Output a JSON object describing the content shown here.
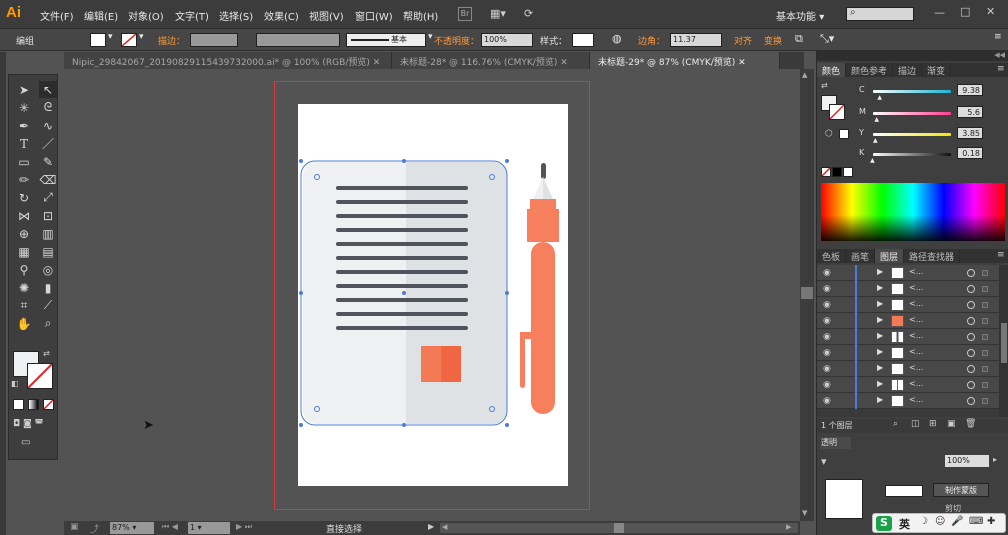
{
  "app": {
    "logo": "Ai"
  },
  "menu": [
    "文件(F)",
    "编辑(E)",
    "对象(O)",
    "文字(T)",
    "选择(S)",
    "效果(C)",
    "视图(V)",
    "窗口(W)",
    "帮助(H)"
  ],
  "workspace": {
    "label": "基本功能",
    "chevron": "▾"
  },
  "search": {
    "icon": "search-icon",
    "placeholder": ""
  },
  "control_bar": {
    "group_label": "编组",
    "stroke_label": "描边：",
    "stroke_style": "基本",
    "opacity_label": "不透明度：",
    "opacity_value": "100%",
    "style_label": "样式：",
    "corner_label": "边角：",
    "corner_value": "11.37",
    "align_label": "对齐",
    "transform_label": "变换"
  },
  "tabs": [
    {
      "label": "Nipic_29842067_20190829115439732000.ai* @ 100% (RGB/预览)",
      "close": "✕"
    },
    {
      "label": "未标题-28* @ 116.76% (CMYK/预览)",
      "close": "✕"
    },
    {
      "label": "未标题-29* @ 87% (CMYK/预览)",
      "close": "✕"
    }
  ],
  "status": {
    "zoom": "87%",
    "page": "1",
    "tool": "直接选择"
  },
  "color_panel": {
    "tabs": [
      "颜色",
      "颜色参考",
      "描边",
      "渐变"
    ],
    "channels": [
      {
        "name": "C",
        "value": "9.38",
        "color": "#17b5d1",
        "level": 0.0938
      },
      {
        "name": "M",
        "value": "5.6",
        "color": "#ff3d91",
        "level": 0.056
      },
      {
        "name": "Y",
        "value": "3.85",
        "color": "#f2e600",
        "level": 0.0385
      },
      {
        "name": "K",
        "value": "0.18",
        "color": "#111111",
        "level": 0.0018
      }
    ]
  },
  "layers_panel": {
    "tabs": [
      "色板",
      "画笔",
      "图层",
      "路径查找器"
    ],
    "rows": [
      {
        "name": "<...",
        "thumb": "white"
      },
      {
        "name": "<...",
        "thumb": "white"
      },
      {
        "name": "<...",
        "thumb": "white"
      },
      {
        "name": "<...",
        "thumb": "orange"
      },
      {
        "name": "<...",
        "thumb": "stripe"
      },
      {
        "name": "<...",
        "thumb": "white"
      },
      {
        "name": "<...",
        "thumb": "white"
      },
      {
        "name": "<...",
        "thumb": "red-line"
      },
      {
        "name": "<...",
        "thumb": "white"
      }
    ],
    "footer": "1 个图层"
  },
  "transparency_panel": {
    "opacity_value": "100%",
    "mask_button": "制作蒙版",
    "clip_label": "剪切"
  },
  "ime": {
    "lang": "英",
    "logo": "S"
  },
  "illustration": {
    "paper_left": "#eef0f1",
    "paper_right": "#dfe2e4",
    "line_color": "#4f545d",
    "square_color": "#f47a56",
    "square_shade": "#f06542",
    "pen_color": "#f6805e",
    "pen_cap": "#4f545d",
    "selection_color": "#4a7cd8"
  }
}
